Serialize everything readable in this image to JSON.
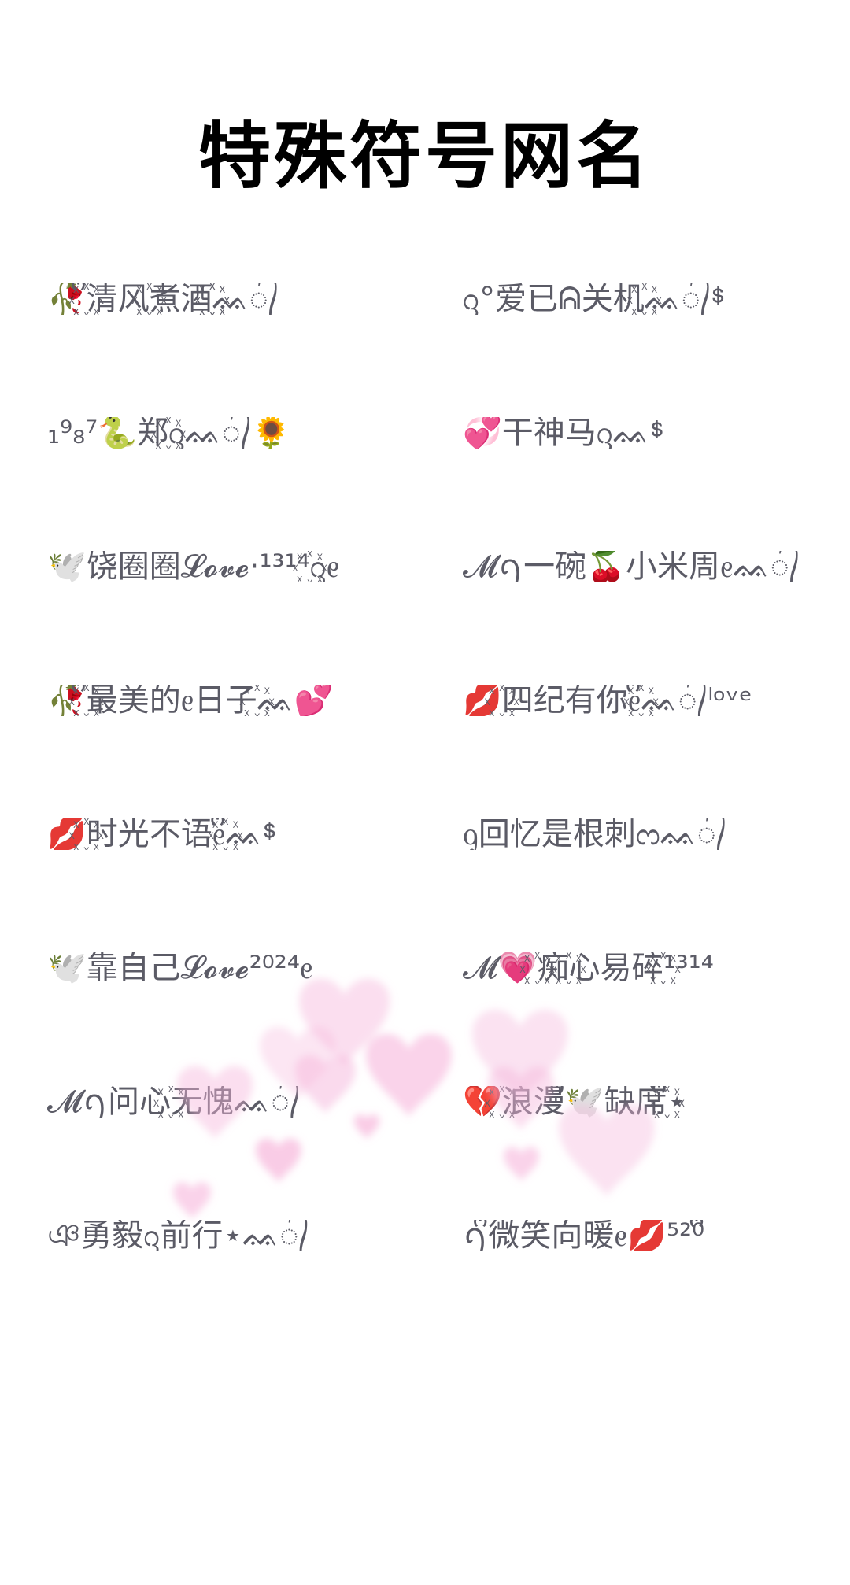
{
  "title": "特殊符号网名",
  "names": [
    "🥀꙰ᩚ清风꙰煮酒꙰꙰ᨐ᭄",
    "ᦋ°爱已ᕱ关机꙰ᨐ᭄ᙚ",
    "₁⁹₈⁷🐍郑꙰ᦋᨐ᭄🌻",
    "💞干神马ᦋᨐᙚ",
    "🕊️饶圈圈𝓛𝓸𝓿𝓮·¹³¹⁴꙰ᦋᧉ",
    "𝓜ꪆ一碗🍒小米周ᧉᨐ᭄",
    "🥀꙰ᩚ最美的ᧉ日子꙰ᨐ💕",
    "💋꙰四纪有你ᧉ꙰ᩚᨐ᭄ˡᵒᵛᵉ",
    "💋꙰时光不语ᧉ꙰ᩚᨐᙚ",
    "ᧁ回忆是根刺ᦂᨐ᭄",
    "🕊️靠自己𝓛𝓸𝓿𝓮²⁰²⁴ᧉ",
    "𝓜💗꙰痴꙰心易碎꙰¹³¹⁴",
    "𝓜ꪆ问心꙰无愧ᨐ᭄",
    "💔꙰浪漫ᩚ🕊️缺席ᩚ꙰⋆",
    "ঞ勇毅ᦋ前行⋆ᨐ᭄",
    "ꪆᩚ微笑向暖ᧉ💋⁵²⁰ᩚ"
  ],
  "colors": {
    "title": "#000000",
    "text": "#5b5b66",
    "heart": "#f6b6dc"
  }
}
